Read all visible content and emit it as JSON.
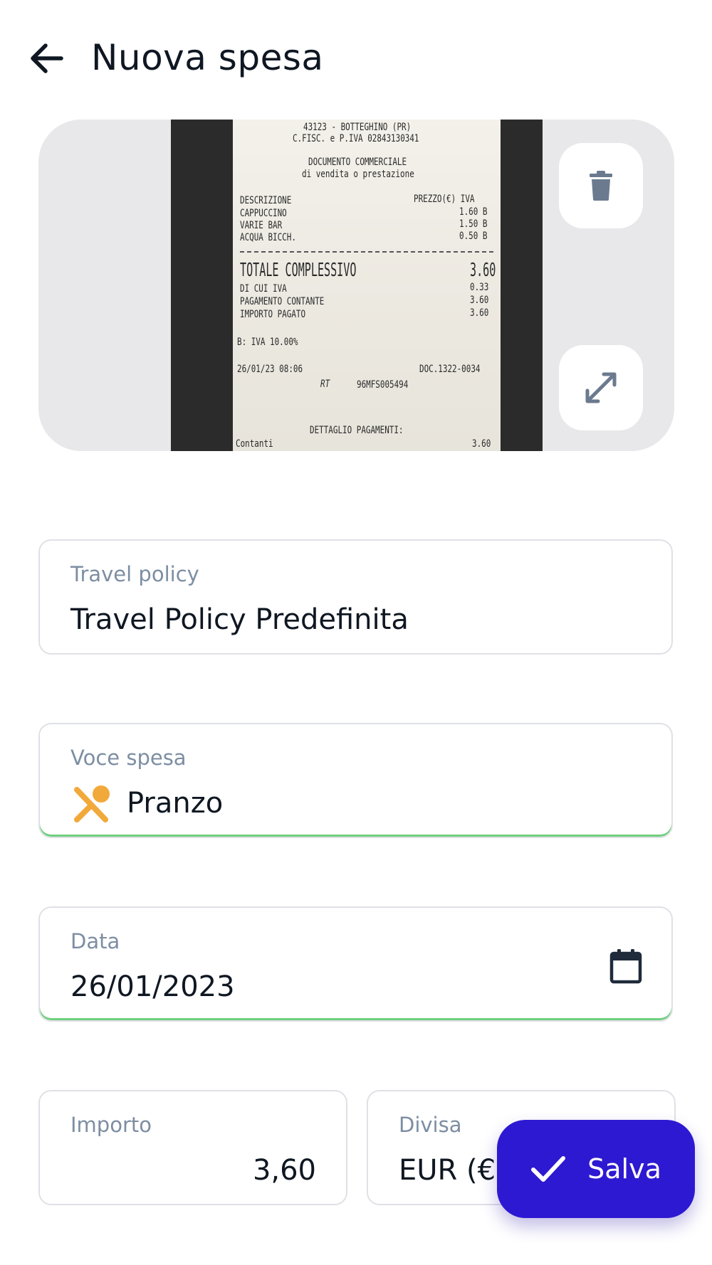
{
  "header": {
    "title": "Nuova spesa",
    "back_icon": "arrow-left-icon"
  },
  "receipt": {
    "lines": [
      "43123 - BOTTEGHINO (PR)",
      "C.FISC. e P.IVA 02843130341",
      "DOCUMENTO COMMERCIALE",
      "di vendita o prestazione",
      "DESCRIZIONE",
      "PREZZO(€) IVA",
      "CAPPUCCINO",
      "1.60 B",
      "VARIE BAR",
      "1.50 B",
      "ACQUA BICCH.",
      "0.50 B",
      "TOTALE COMPLESSIVO",
      "3.60",
      "DI CUI IVA",
      "0.33",
      "PAGAMENTO CONTANTE",
      "3.60",
      "IMPORTO PAGATO",
      "3.60",
      "B: IVA 10.00%",
      "26/01/23 08:06",
      "DOC.1322-0034",
      "RT",
      "96MFS005494",
      "DETTAGLIO PAGAMENTI:",
      "Contanti",
      "3.60"
    ],
    "delete_icon": "trash-icon",
    "expand_icon": "expand-icon"
  },
  "fields": {
    "travel_policy": {
      "label": "Travel policy",
      "value": "Travel Policy Predefinita"
    },
    "voce_spesa": {
      "label": "Voce spesa",
      "value": "Pranzo",
      "icon": "cutlery-icon",
      "icon_color": "#f2a93b"
    },
    "data": {
      "label": "Data",
      "value": "26/01/2023",
      "icon": "calendar-icon"
    },
    "importo": {
      "label": "Importo",
      "value": "3,60"
    },
    "divisa": {
      "label": "Divisa",
      "value": "EUR (€)"
    }
  },
  "actions": {
    "save_label": "Salva",
    "save_icon": "check-icon",
    "accent": "#2e19d2",
    "valid_color": "#6fcf7e"
  }
}
